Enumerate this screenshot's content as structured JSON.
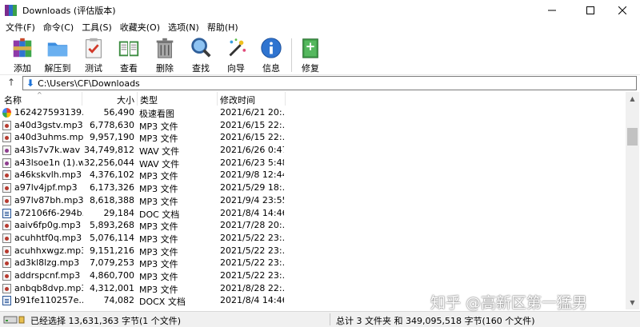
{
  "window": {
    "title": "Downloads (评估版本)"
  },
  "menu": [
    "文件(F)",
    "命令(C)",
    "工具(S)",
    "收藏夹(O)",
    "选项(N)",
    "帮助(H)"
  ],
  "toolbar": [
    {
      "label": "添加",
      "icon": "add-archive-icon"
    },
    {
      "label": "解压到",
      "icon": "extract-folder-icon"
    },
    {
      "label": "测试",
      "icon": "test-clipboard-icon"
    },
    {
      "label": "查看",
      "icon": "view-book-icon"
    },
    {
      "label": "删除",
      "icon": "delete-trash-icon"
    },
    {
      "label": "查找",
      "icon": "find-magnifier-icon"
    },
    {
      "label": "向导",
      "icon": "wizard-wand-icon"
    },
    {
      "label": "信息",
      "icon": "info-icon"
    },
    {
      "label": "修复",
      "icon": "repair-book-icon"
    }
  ],
  "address": {
    "path": "C:\\Users\\CF\\Downloads"
  },
  "columns": {
    "name": "名称",
    "size": "大小",
    "type": "类型",
    "modified": "修改时间"
  },
  "files": [
    {
      "name": "162427593139...",
      "size": "56,490",
      "type": "极速看图",
      "modified": "2021/6/21 20:...",
      "kind": "img"
    },
    {
      "name": "a40d3gstv.mp3",
      "size": "6,778,630",
      "type": "MP3 文件",
      "modified": "2021/6/15 22:...",
      "kind": "mp3"
    },
    {
      "name": "a40d3uhms.mp3",
      "size": "9,957,190",
      "type": "MP3 文件",
      "modified": "2021/6/15 22:...",
      "kind": "mp3"
    },
    {
      "name": "a43ls7v7k.wav",
      "size": "34,749,812",
      "type": "WAV 文件",
      "modified": "2021/6/26 0:47",
      "kind": "wav"
    },
    {
      "name": "a43lsoe1n (1).w...",
      "size": "32,256,044",
      "type": "WAV 文件",
      "modified": "2021/6/23 5:48",
      "kind": "wav"
    },
    {
      "name": "a46kskvlh.mp3",
      "size": "4,376,102",
      "type": "MP3 文件",
      "modified": "2021/9/8 12:44",
      "kind": "mp3"
    },
    {
      "name": "a97lv4jpf.mp3",
      "size": "6,173,326",
      "type": "MP3 文件",
      "modified": "2021/5/29 18:...",
      "kind": "mp3"
    },
    {
      "name": "a97lv87bh.mp3",
      "size": "8,618,388",
      "type": "MP3 文件",
      "modified": "2021/9/4 23:55",
      "kind": "mp3"
    },
    {
      "name": "a72106f6-294b...",
      "size": "29,184",
      "type": "DOC 文档",
      "modified": "2021/8/4 14:46",
      "kind": "doc"
    },
    {
      "name": "aaiv6fp0g.mp3",
      "size": "5,893,268",
      "type": "MP3 文件",
      "modified": "2021/7/28 20:...",
      "kind": "mp3"
    },
    {
      "name": "acuhhtf0q.mp3",
      "size": "5,076,114",
      "type": "MP3 文件",
      "modified": "2021/5/22 23:...",
      "kind": "mp3"
    },
    {
      "name": "acuhhxwgz.mp3",
      "size": "9,151,216",
      "type": "MP3 文件",
      "modified": "2021/5/22 23:...",
      "kind": "mp3"
    },
    {
      "name": "ad3kl8lzg.mp3",
      "size": "7,079,253",
      "type": "MP3 文件",
      "modified": "2021/5/22 23:...",
      "kind": "mp3"
    },
    {
      "name": "addrspcnf.mp3",
      "size": "4,860,700",
      "type": "MP3 文件",
      "modified": "2021/5/22 23:...",
      "kind": "mp3"
    },
    {
      "name": "anbqb8dvp.mp3",
      "size": "4,312,001",
      "type": "MP3 文件",
      "modified": "2021/8/28 22:...",
      "kind": "mp3"
    },
    {
      "name": "b91fe110257e...",
      "size": "74,082",
      "type": "DOCX 文档",
      "modified": "2021/8/4 14:46",
      "kind": "doc"
    }
  ],
  "status": {
    "left": "已经选择 13,631,363 字节(1 个文件)",
    "right": "总计 3 文件夹 和 349,095,518 字节(160 个文件)"
  },
  "watermark": "知乎 @高新区第一猛男"
}
